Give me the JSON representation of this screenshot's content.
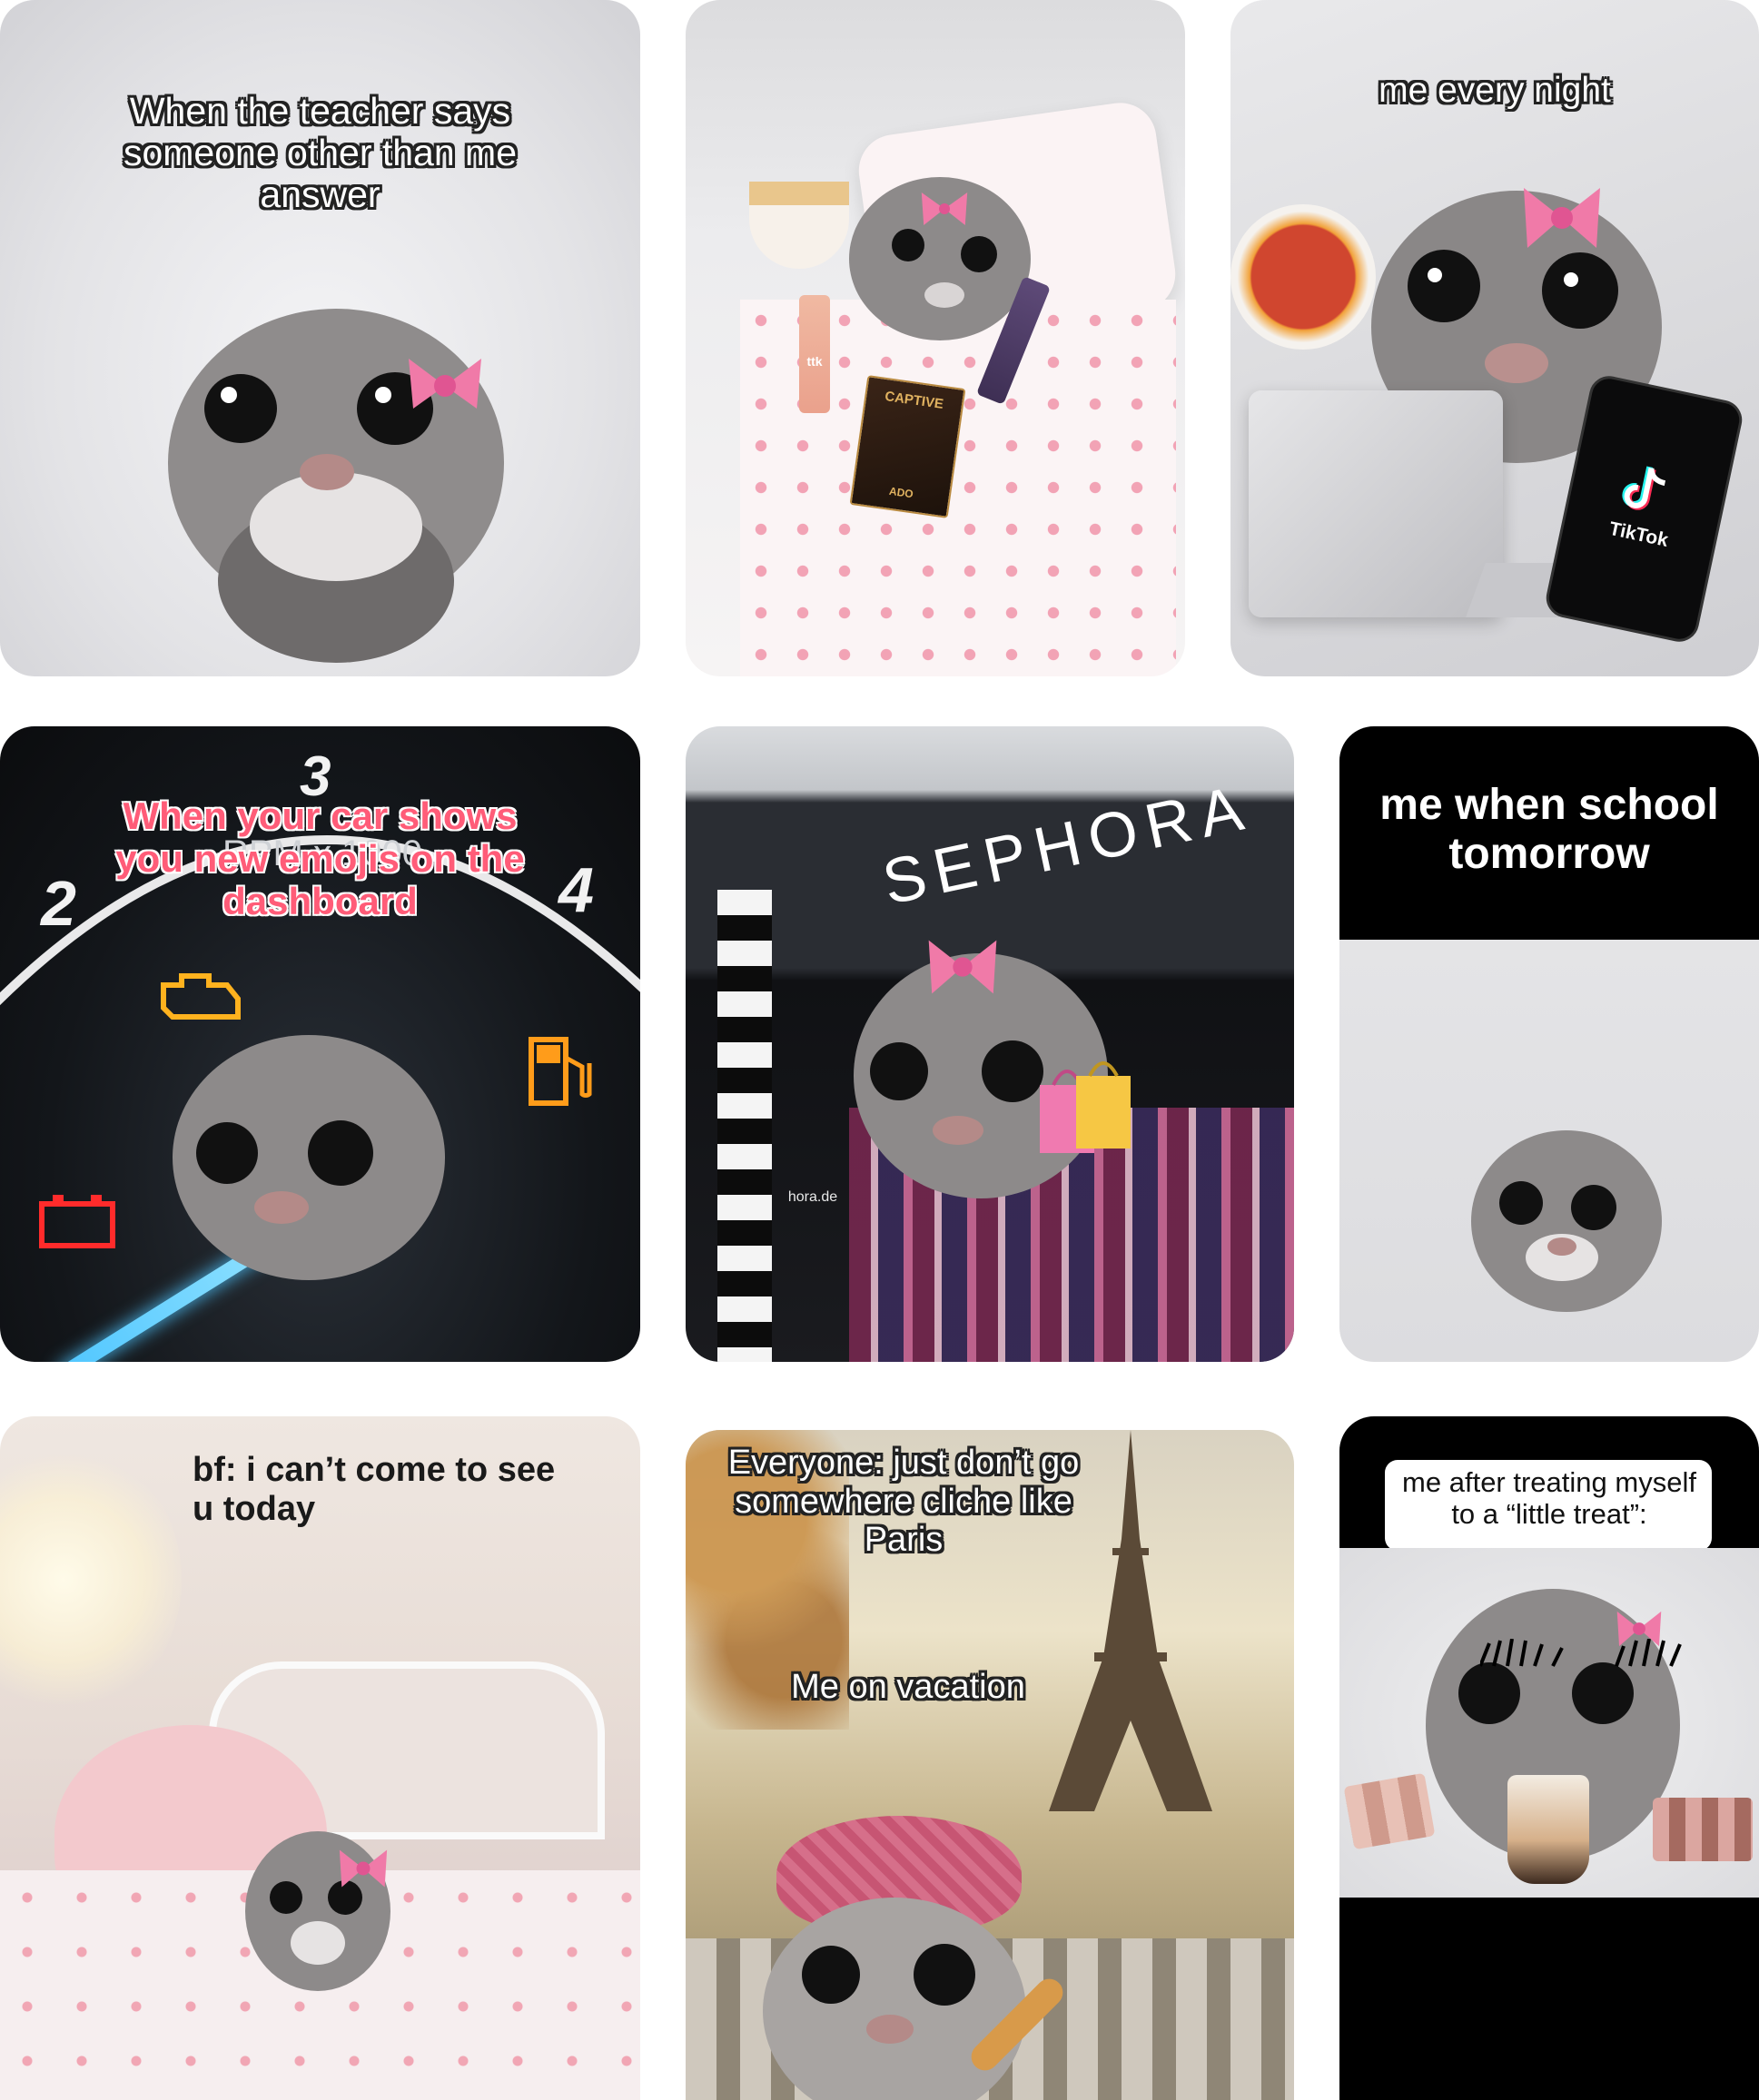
{
  "colors": {
    "page_bg": "#ffffff",
    "hamster_fur": "#8d8a8a",
    "bow_pink": "#f07aa8",
    "sephora_dark": "#2a2d33",
    "dash_dark": "#15181c"
  },
  "cards": [
    {
      "id": "teacher",
      "caption": "When the teacher says\nsomeone other than me\nanswer"
    },
    {
      "id": "bed",
      "stickers": {
        "book_title": "CAPTIVE",
        "book_sub": "ADO",
        "brand": "ttk"
      }
    },
    {
      "id": "every-night",
      "caption": "me every night",
      "phone_logo": "TikTok"
    },
    {
      "id": "car",
      "caption": "When your car shows\nyou new emojis on the\ndashboard",
      "gauge": {
        "rpm": "RPM x 1000",
        "n2": "2",
        "n3": "3",
        "n4": "4"
      }
    },
    {
      "id": "sephora",
      "store_sign": "SEPHORA",
      "store_small": "hora.de"
    },
    {
      "id": "school",
      "caption": "me when school\ntomorrow"
    },
    {
      "id": "bf",
      "caption": "bf: i can’t come to see\nu today"
    },
    {
      "id": "paris",
      "caption_top": "Everyone: just don’t go\nsomewhere cliche like\nParis",
      "caption_mid": "Me on vacation"
    },
    {
      "id": "treat",
      "caption": "me after treating myself\nto a “little treat”:"
    }
  ]
}
